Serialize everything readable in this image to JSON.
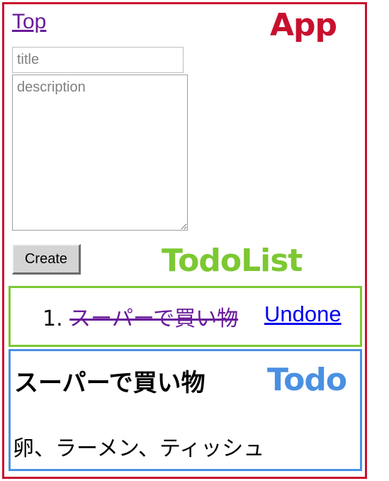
{
  "app": {
    "label": "App",
    "nav": {
      "top_link": "Top"
    },
    "form": {
      "title_placeholder": "title",
      "title_value": "",
      "description_placeholder": "description",
      "description_value": "",
      "create_label": "Create"
    }
  },
  "todo_list": {
    "label": "TodoList",
    "items": [
      {
        "number": "1.",
        "title": "スーパーで買い物",
        "done": true,
        "toggle_label": "Undone"
      }
    ]
  },
  "todo": {
    "label": "Todo",
    "title": "スーパーで買い物",
    "description": "卵、ラーメン、ティッシュ"
  },
  "colors": {
    "app_border": "#c8102e",
    "todolist_border": "#7cc832",
    "todo_border": "#4a90e2",
    "visited_link": "#6a1b9a",
    "link": "#0000ee"
  }
}
